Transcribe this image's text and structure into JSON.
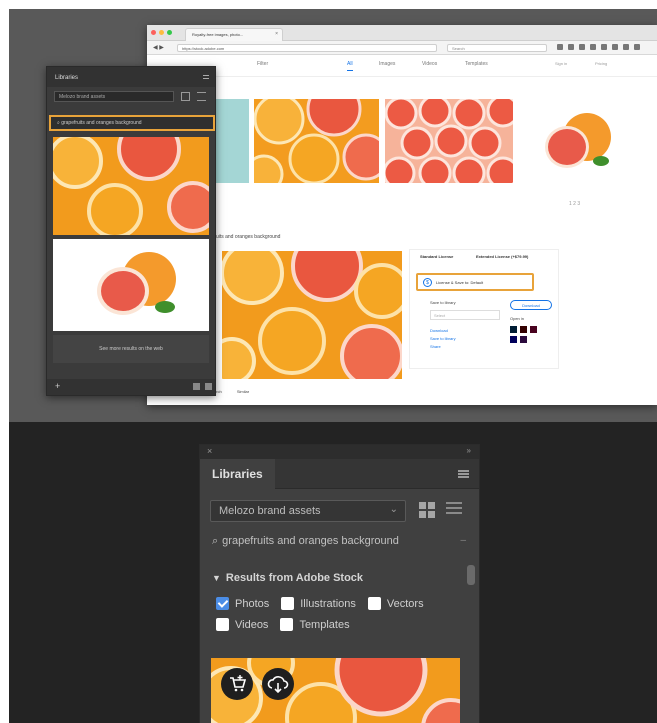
{
  "top_scene": {
    "browser": {
      "tab_title": "Royalty-free images, photo...",
      "url": "https://stock.adobe.com",
      "search_placeholder": "Search",
      "nav": {
        "filter_label": "Filter",
        "tabs": [
          "All",
          "Images",
          "Videos",
          "Templates"
        ],
        "right_links": [
          "Sign in",
          "Pricing"
        ]
      },
      "pager": "1  2  3",
      "detail_title": "Grapefruits and oranges background",
      "license": {
        "tab_standard": "Standard License",
        "tab_extended": "Extended License (+$79.99)",
        "button_label": "License & Save to: Default",
        "save_to_label": "Save to library",
        "dropdown_value": "Select",
        "download_label": "Download",
        "open_in_label": "Open in",
        "links": [
          "Download",
          "Save to library",
          "Share"
        ]
      },
      "bottom_tabs": [
        "Search",
        "Similar"
      ]
    },
    "small_panel": {
      "title": "Libraries",
      "brand": "Melozo brand assets",
      "search_value": "grapefruits and oranges background",
      "see_more": "See more results on the web"
    }
  },
  "panel": {
    "title": "Libraries",
    "library_select": "Melozo brand assets",
    "search_value": "grapefruits and oranges background",
    "results_header": "Results from Adobe Stock",
    "filters": [
      {
        "label": "Photos",
        "checked": true
      },
      {
        "label": "Illustrations",
        "checked": false
      },
      {
        "label": "Vectors",
        "checked": false
      },
      {
        "label": "Videos",
        "checked": false
      },
      {
        "label": "Templates",
        "checked": false
      }
    ],
    "icons": {
      "close": "close-icon",
      "collapse": "collapse-icon",
      "menu": "menu-icon",
      "grid_view": "grid-view-icon",
      "list_view": "list-view-icon",
      "search": "search-icon",
      "license": "license-cart-icon",
      "save": "cloud-save-icon"
    }
  }
}
